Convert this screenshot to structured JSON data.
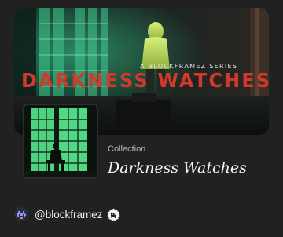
{
  "collection": {
    "banner": {
      "tagline": "A BLOCKFRAMEZ SERIES",
      "title": "DARKNESS WATCHES"
    },
    "kind_label": "Collection",
    "name": "Darkness Watches"
  },
  "creator": {
    "handle": "@blockframez",
    "avatar_icon": "space-invader-avatar-icon",
    "badge_icon": "verified-creator-badge-icon"
  },
  "colors": {
    "background": "#212121",
    "banner_title": "#d2392c",
    "glow_green": "#6fe3a6",
    "text_primary": "#f5f5f5",
    "text_secondary": "#b9b9b9"
  }
}
